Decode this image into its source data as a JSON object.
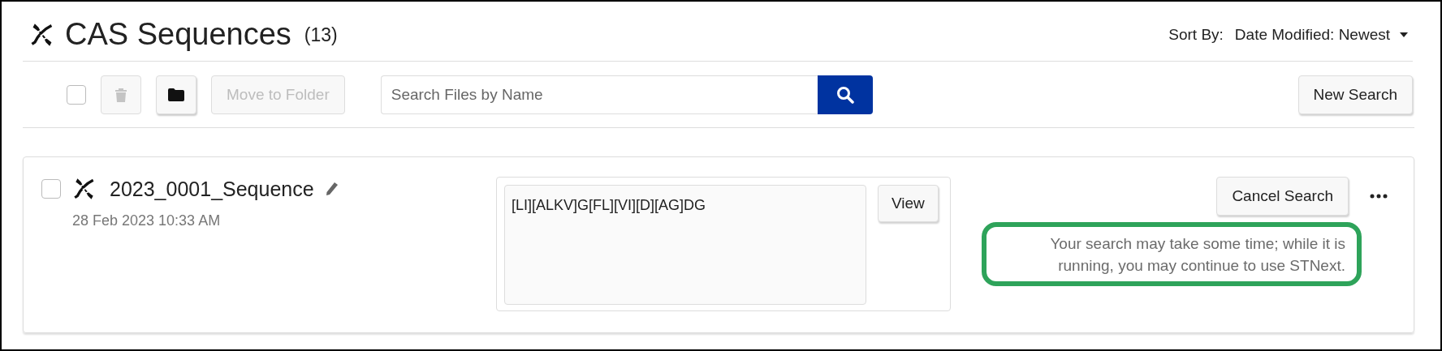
{
  "header": {
    "title": "CAS Sequences",
    "count": "(13)",
    "sort": {
      "label": "Sort By:",
      "value": "Date Modified: Newest"
    }
  },
  "toolbar": {
    "select_all": {
      "checked": false
    },
    "delete": {
      "disabled": true
    },
    "folder": {
      "disabled": false
    },
    "move_button": {
      "label": "Move to Folder",
      "disabled": true
    },
    "search": {
      "placeholder": "Search Files by Name"
    },
    "new_search": "New Search"
  },
  "items": [
    {
      "name": "2023_0001_Sequence",
      "date": "28 Feb 2023 10:33 AM",
      "checked": false,
      "sequence": "[LI][ALKV]G[FL][VI][D][AG]DG",
      "view": "View",
      "cancel": "Cancel Search",
      "message": "Your search may take some time; while it is running, you may continue to use STNext.",
      "highlighted": true
    }
  ]
}
